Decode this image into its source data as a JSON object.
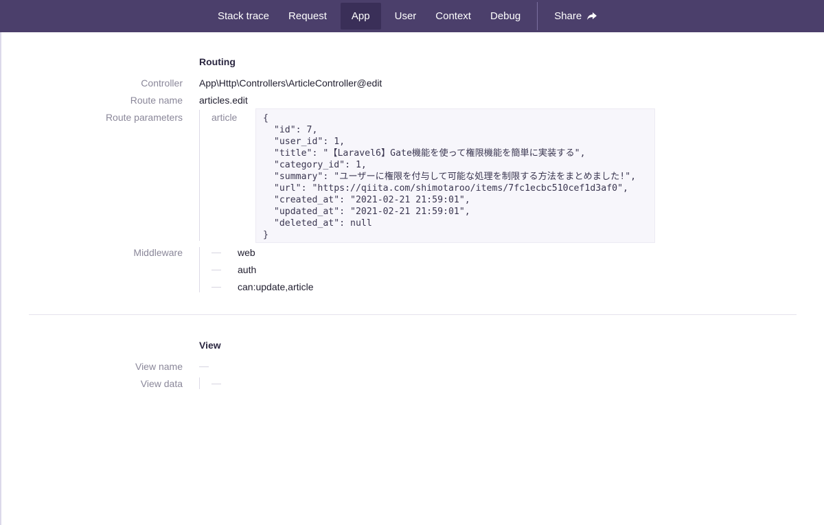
{
  "nav": {
    "tabs": [
      {
        "label": "Stack trace",
        "active": false
      },
      {
        "label": "Request",
        "active": false
      },
      {
        "label": "App",
        "active": true
      },
      {
        "label": "User",
        "active": false
      },
      {
        "label": "Context",
        "active": false
      },
      {
        "label": "Debug",
        "active": false
      }
    ],
    "share_label": "Share"
  },
  "routing": {
    "title": "Routing",
    "controller_label": "Controller",
    "controller_value": "App\\Http\\Controllers\\ArticleController@edit",
    "route_name_label": "Route name",
    "route_name_value": "articles.edit",
    "route_params_label": "Route parameters",
    "param_key": "article",
    "param_json": "{\n  \"id\": 7,\n  \"user_id\": 1,\n  \"title\": \"【Laravel6】Gate機能を使って権限機能を簡単に実装する\",\n  \"category_id\": 1,\n  \"summary\": \"ユーザーに権限を付与して可能な処理を制限する方法をまとめました!\",\n  \"url\": \"https://qiita.com/shimotaroo/items/7fc1ecbc510cef1d3af0\",\n  \"created_at\": \"2021-02-21 21:59:01\",\n  \"updated_at\": \"2021-02-21 21:59:01\",\n  \"deleted_at\": null\n}",
    "middleware_label": "Middleware",
    "middleware": [
      "web",
      "auth",
      "can:update,article"
    ]
  },
  "view": {
    "title": "View",
    "view_name_label": "View name",
    "view_data_label": "View data"
  },
  "colors": {
    "nav_bg": "#4b3f6b",
    "nav_active": "#3a2f58"
  }
}
